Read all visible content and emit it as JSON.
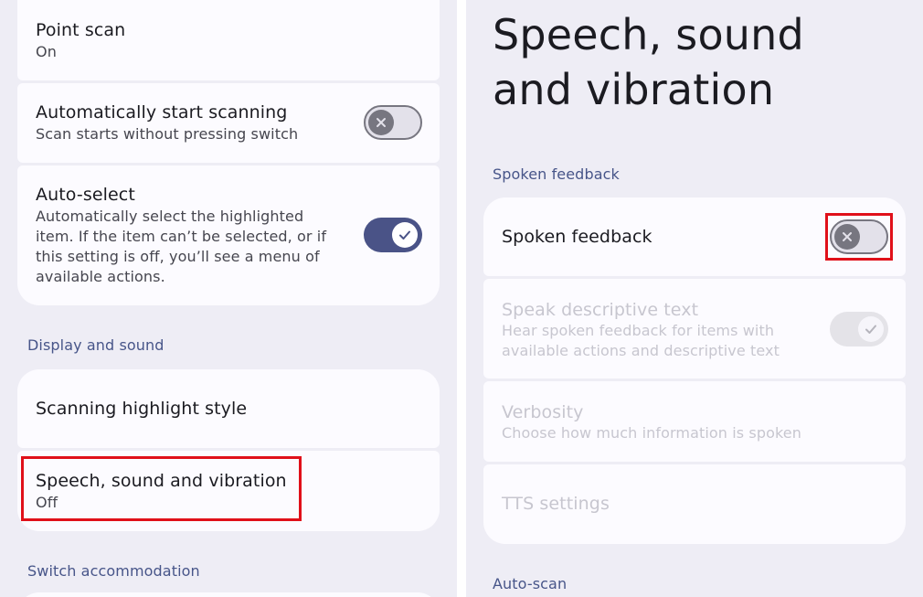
{
  "left": {
    "point_scan": {
      "title": "Point scan",
      "value": "On"
    },
    "auto_start": {
      "title": "Automatically start scanning",
      "subtitle": "Scan starts without pressing switch"
    },
    "auto_select": {
      "title": "Auto-select",
      "subtitle": "Automatically select the highlighted item. If the item can’t be selected, or if this setting is off, you’ll see a menu of available actions."
    },
    "section_display": "Display and sound",
    "highlight_style": {
      "title": "Scanning highlight style"
    },
    "speech": {
      "title": "Speech, sound and vibration",
      "value": "Off"
    },
    "section_switch": "Switch accommodation"
  },
  "right": {
    "page_title": "Speech, sound and vibration",
    "section_spoken": "Spoken feedback",
    "spoken_feedback": {
      "title": "Spoken feedback"
    },
    "speak_descriptive": {
      "title": "Speak descriptive text",
      "subtitle": "Hear spoken feedback for items with available actions and descriptive text"
    },
    "verbosity": {
      "title": "Verbosity",
      "subtitle": "Choose how much information is spoken"
    },
    "tts": {
      "title": "TTS settings"
    },
    "section_autoscan": "Auto-scan"
  },
  "colors": {
    "background": "#eeedf5",
    "card": "#fcfbff",
    "accent": "#4a5387",
    "section_text": "#475589",
    "highlight_box": "#e0101a"
  },
  "icons": {
    "switch_off": "close-icon",
    "switch_on": "check-icon"
  }
}
